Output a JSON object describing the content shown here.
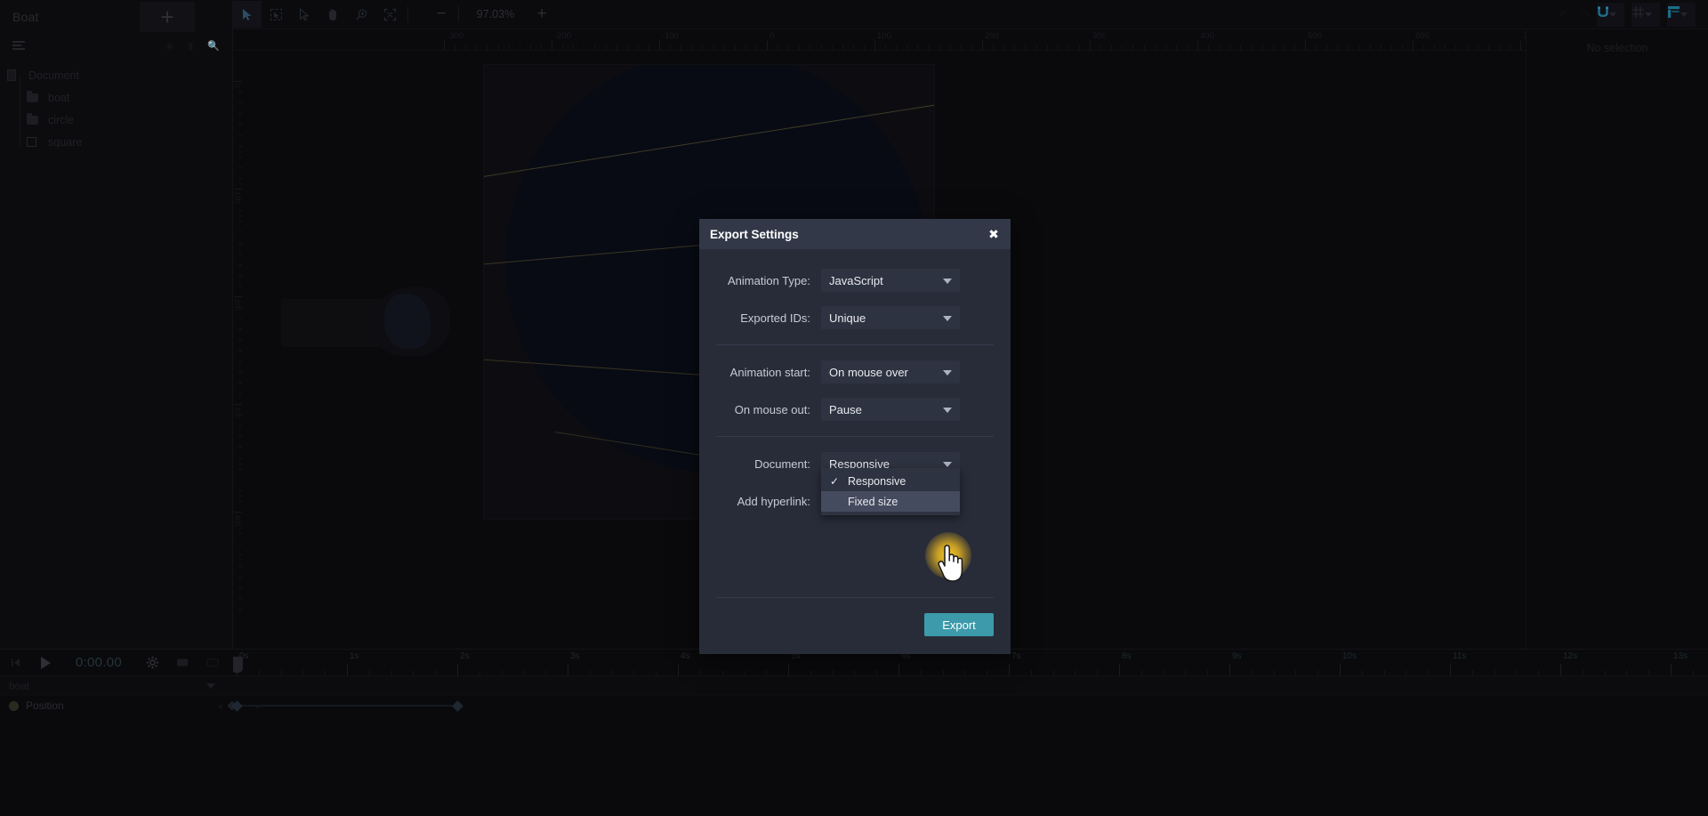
{
  "sidebar": {
    "project_title": "Boat",
    "add_button_label": "+",
    "tree": [
      {
        "label": "Document",
        "icon": "document-icon",
        "level": 0
      },
      {
        "label": "boat",
        "icon": "folder-icon",
        "level": 1
      },
      {
        "label": "circle",
        "icon": "folder-icon",
        "level": 1
      },
      {
        "label": "square",
        "icon": "square-icon",
        "level": 1
      }
    ]
  },
  "toolbar": {
    "tools": [
      {
        "name": "select-tool-icon",
        "active": true
      },
      {
        "name": "transform-tool-icon",
        "active": false
      },
      {
        "name": "direct-select-tool-icon",
        "active": false
      },
      {
        "name": "hand-tool-icon",
        "active": false
      },
      {
        "name": "zoom-tool-icon",
        "active": false
      },
      {
        "name": "fit-to-screen-icon",
        "active": false
      }
    ],
    "zoom_out_label": "−",
    "zoom_value": "97.03%",
    "zoom_in_label": "+",
    "right_chips": [
      {
        "name": "snap-magnet-icon"
      },
      {
        "name": "grid-icon"
      },
      {
        "name": "rulers-guides-icon"
      }
    ]
  },
  "right_panel": {
    "empty_state": "No selection"
  },
  "canvas": {
    "ruler_h_labels": [
      "-300",
      "-200",
      "-100",
      "0",
      "100",
      "200",
      "300",
      "400",
      "500",
      "600",
      "700"
    ],
    "ruler_v_labels": [
      "0",
      "100",
      "200",
      "300",
      "400"
    ]
  },
  "timeline": {
    "play_label": "play-icon",
    "timecode": "0:00.00",
    "settings_label": "gear-icon",
    "ruler_labels": [
      "0s",
      "1s",
      "2s",
      "3s",
      "4s",
      "5s",
      "6s",
      "7s",
      "8s",
      "9s",
      "10s",
      "11s",
      "12s",
      "13s"
    ],
    "track_name": "boat",
    "property_name": "Position",
    "keyframes_seconds": [
      0,
      2
    ]
  },
  "dialog": {
    "title": "Export Settings",
    "close_label": "✖",
    "fields": [
      {
        "label": "Animation Type:",
        "value": "JavaScript"
      },
      {
        "label": "Exported IDs:",
        "value": "Unique"
      },
      {
        "label": "Animation start:",
        "value": "On mouse over"
      },
      {
        "label": "On mouse out:",
        "value": "Pause"
      },
      {
        "label": "Document:",
        "value": "Responsive"
      },
      {
        "label": "Add hyperlink:",
        "value": ""
      }
    ],
    "document_dropdown": {
      "open": true,
      "options": [
        {
          "label": "Responsive",
          "checked": true,
          "highlighted": false
        },
        {
          "label": "Fixed size",
          "checked": false,
          "highlighted": true
        }
      ],
      "check_glyph": "✓"
    },
    "export_button": "Export"
  },
  "colors": {
    "accent_export": "#3c9aab",
    "dialog_bg": "#282c39",
    "dialog_header": "#323848",
    "select_bg": "#2e3341",
    "highlight": "#454b5e",
    "click_glow": "#ffd228"
  }
}
